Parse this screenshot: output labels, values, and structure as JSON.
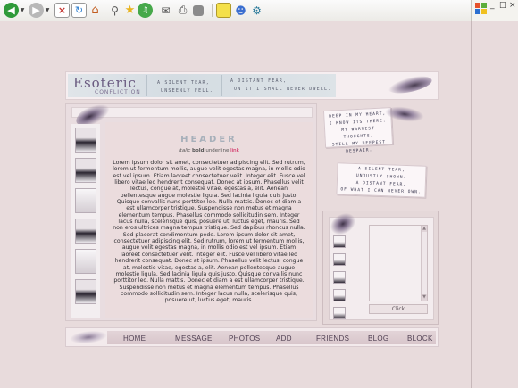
{
  "browser": {
    "toolbar_icons": [
      "back-icon",
      "forward-icon",
      "stop-icon",
      "refresh-icon",
      "home-icon",
      "search-icon",
      "favorites-icon",
      "media-icon",
      "mail-icon",
      "print-icon",
      "edit-icon",
      "notes-icon",
      "messenger-icon",
      "research-icon"
    ],
    "colors": {
      "back": "#2f9a3a",
      "stop": "#c4322e",
      "refresh": "#2f7fcf"
    }
  },
  "banner": {
    "logo": "Esoteric",
    "logo_sub": "CONFLICTION",
    "quote_one_line1": "A SILENT TEAR,",
    "quote_one_line2": "UNSEENLY FELL.",
    "quote_two_line1": "A DISTANT FEAR,",
    "quote_two_line2": "ON IT I SHALL NEVER DWELL."
  },
  "content": {
    "header": "HEADER",
    "italic": "italic",
    "bold": "bold",
    "underline": "underline",
    "link": "link",
    "body": "Lorem ipsum dolor sit amet, consectetuer adipiscing elit. Sed rutrum, lorem ut fermentum mollis, augue velit egestas magna, in mollis odio est vel ipsum. Etiam laoreet consectetuer velit. Integer elit. Fusce vel libero vitae leo hendrerit consequat. Donec at ipsum. Phasellus velit lectus, congue at, molestie vitae, egestas a, elit. Aenean pellentesque augue molestie ligula. Sed lacinia ligula quis justo. Quisque convallis nunc porttitor leo. Nulla mattis. Donec et diam a est ullamcorper tristique. Suspendisse non metus et magna elementum tempus. Phasellus commodo sollicitudin sem. Integer lacus nulla, scelerisque quis, posuere ut, luctus eget, mauris. Sed non eros ultrices magna tempus tristique. Sed dapibus rhoncus nulla. Sed placerat condimentum pede. Lorem ipsum dolor sit amet, consectetuer adipiscing elit. Sed rutrum, lorem ut fermentum mollis, augue velit egestas magna, in mollis odio est vel ipsum. Etiam laoreet consectetuer velit. Integer elit. Fusce vel libero vitae leo hendrerit consequat. Donec at ipsum. Phasellus velit lectus, congue at, molestie vitae, egestas a, elit. Aenean pellentesque augue molestie ligula. Sed lacinia ligula quis justo. Quisque convallis nunc porttitor leo. Nulla mattis. Donec et diam a est ullamcorper tristique. Suspendisse non metus et magna elementum tempus. Phasellus commodo sollicitudin sem. Integer lacus nulla, scelerisque quis, posuere ut, luctus eget, mauris."
  },
  "notes": {
    "note1_line1": "DEEP IN MY HEART,",
    "note1_line2": "I KNOW ITS THERE.",
    "note1_line3": "MY WARMEST THOUGHTS,",
    "note1_line4": "STILL MY DEEPEST DESPAIR.",
    "note2_line1": "A SILENT TEAR,",
    "note2_line2": "UNJUSTLY SHOWN.",
    "note2_line3": "A DISTANT FEAR,",
    "note2_line4": "OF WHAT I CAN NEVER OWN."
  },
  "tagboard": {
    "button": "Click",
    "scroll_up": "▲",
    "scroll_down": "▼"
  },
  "nav": {
    "items": [
      "HOME",
      "MESSAGE",
      "PHOTOS",
      "ADD",
      "FRIENDS",
      "BLOG",
      "BLOCK"
    ]
  },
  "window": {
    "minimize": "_",
    "maximize": "□",
    "close": "×"
  }
}
